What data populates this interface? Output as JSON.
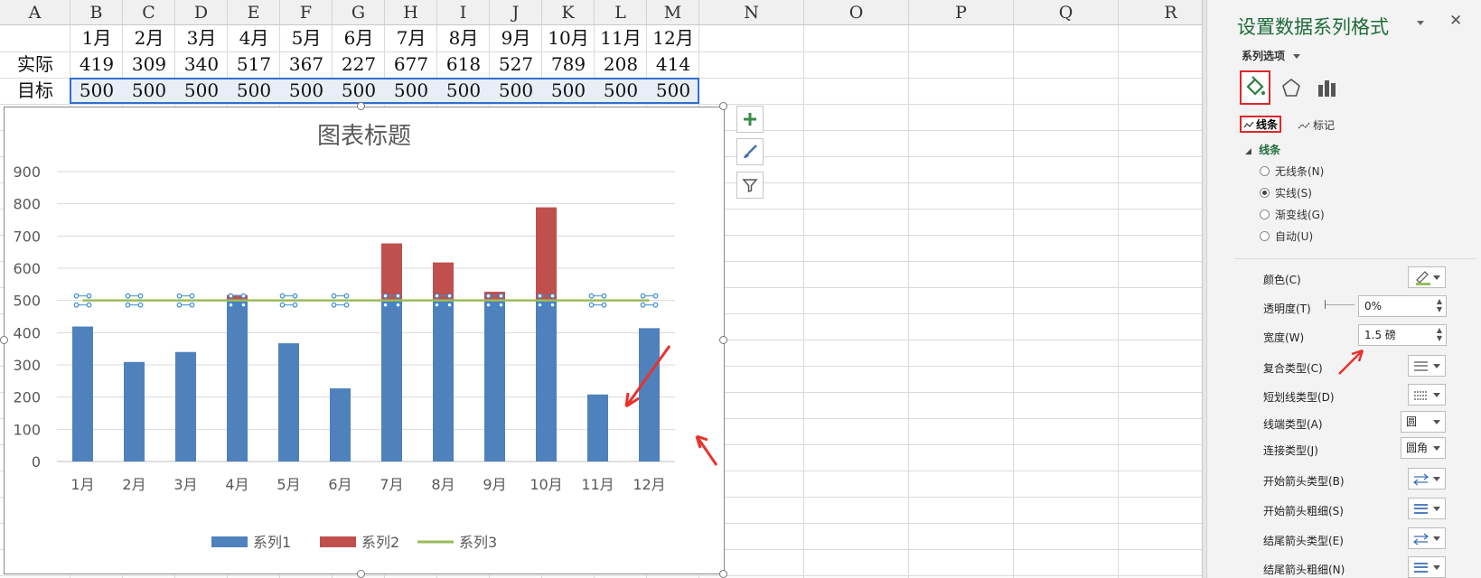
{
  "sheet": {
    "columns": [
      {
        "label": "A",
        "w": 78
      },
      {
        "label": "B",
        "w": 58
      },
      {
        "label": "C",
        "w": 58
      },
      {
        "label": "D",
        "w": 58
      },
      {
        "label": "E",
        "w": 58
      },
      {
        "label": "F",
        "w": 58
      },
      {
        "label": "G",
        "w": 58
      },
      {
        "label": "H",
        "w": 58
      },
      {
        "label": "I",
        "w": 58
      },
      {
        "label": "J",
        "w": 58
      },
      {
        "label": "K",
        "w": 58
      },
      {
        "label": "L",
        "w": 58
      },
      {
        "label": "M",
        "w": 58
      },
      {
        "label": "N",
        "w": 116
      },
      {
        "label": "O",
        "w": 116
      },
      {
        "label": "P",
        "w": 116
      },
      {
        "label": "Q",
        "w": 116
      },
      {
        "label": "R",
        "w": 116
      }
    ],
    "rows": [
      [
        "",
        "1月",
        "2月",
        "3月",
        "4月",
        "5月",
        "6月",
        "7月",
        "8月",
        "9月",
        "10月",
        "11月",
        "12月"
      ],
      [
        "实际",
        "419",
        "309",
        "340",
        "517",
        "367",
        "227",
        "677",
        "618",
        "527",
        "789",
        "208",
        "414"
      ],
      [
        "目标",
        "500",
        "500",
        "500",
        "500",
        "500",
        "500",
        "500",
        "500",
        "500",
        "500",
        "500",
        "500"
      ]
    ]
  },
  "chart_data": {
    "type": "bar",
    "title": "图表标题",
    "categories": [
      "1月",
      "2月",
      "3月",
      "4月",
      "5月",
      "6月",
      "7月",
      "8月",
      "9月",
      "10月",
      "11月",
      "12月"
    ],
    "ylim": [
      0,
      900
    ],
    "yticks": [
      0,
      100,
      200,
      300,
      400,
      500,
      600,
      700,
      800,
      900
    ],
    "series": [
      {
        "name": "系列1",
        "kind": "stacked-bar",
        "color": "#4f81bd",
        "values": [
          419,
          309,
          340,
          500,
          367,
          227,
          500,
          500,
          500,
          500,
          208,
          414
        ]
      },
      {
        "name": "系列2",
        "kind": "stacked-bar",
        "color": "#c0504d",
        "values": [
          0,
          0,
          0,
          17,
          0,
          0,
          177,
          118,
          27,
          289,
          0,
          0
        ]
      },
      {
        "name": "系列3",
        "kind": "line",
        "color": "#9bbb59",
        "values": [
          500,
          500,
          500,
          500,
          500,
          500,
          500,
          500,
          500,
          500,
          500,
          500
        ]
      }
    ],
    "legend": "bottom",
    "grid": true
  },
  "chart_buttons": [
    {
      "name": "chart-elements-button",
      "icon": "plus-icon"
    },
    {
      "name": "chart-styles-button",
      "icon": "brush-icon"
    },
    {
      "name": "chart-filter-button",
      "icon": "filter-icon"
    }
  ],
  "panel": {
    "title": "设置数据系列格式",
    "series_options": "系列选项",
    "tabs": {
      "line": "线条",
      "marker": "标记"
    },
    "section": "线条",
    "radios": [
      {
        "label": "无线条(N)",
        "checked": false
      },
      {
        "label": "实线(S)",
        "checked": true
      },
      {
        "label": "渐变线(G)",
        "checked": false
      },
      {
        "label": "自动(U)",
        "checked": false
      }
    ],
    "props": {
      "color": "颜色(C)",
      "transparency": "透明度(T)",
      "transparency_value": "0%",
      "width": "宽度(W)",
      "width_value": "1.5 磅",
      "compound": "复合类型(C)",
      "dash": "短划线类型(D)",
      "cap": "线端类型(A)",
      "cap_value": "圆",
      "join": "连接类型(J)",
      "join_value": "圆角",
      "begin_arrow_type": "开始箭头类型(B)",
      "begin_arrow_size": "开始箭头粗细(S)",
      "end_arrow_type": "结尾箭头类型(E)",
      "end_arrow_size": "结尾箭头粗细(N)"
    },
    "accent": "#1f6b3a",
    "line_color": "#9bbb59"
  }
}
